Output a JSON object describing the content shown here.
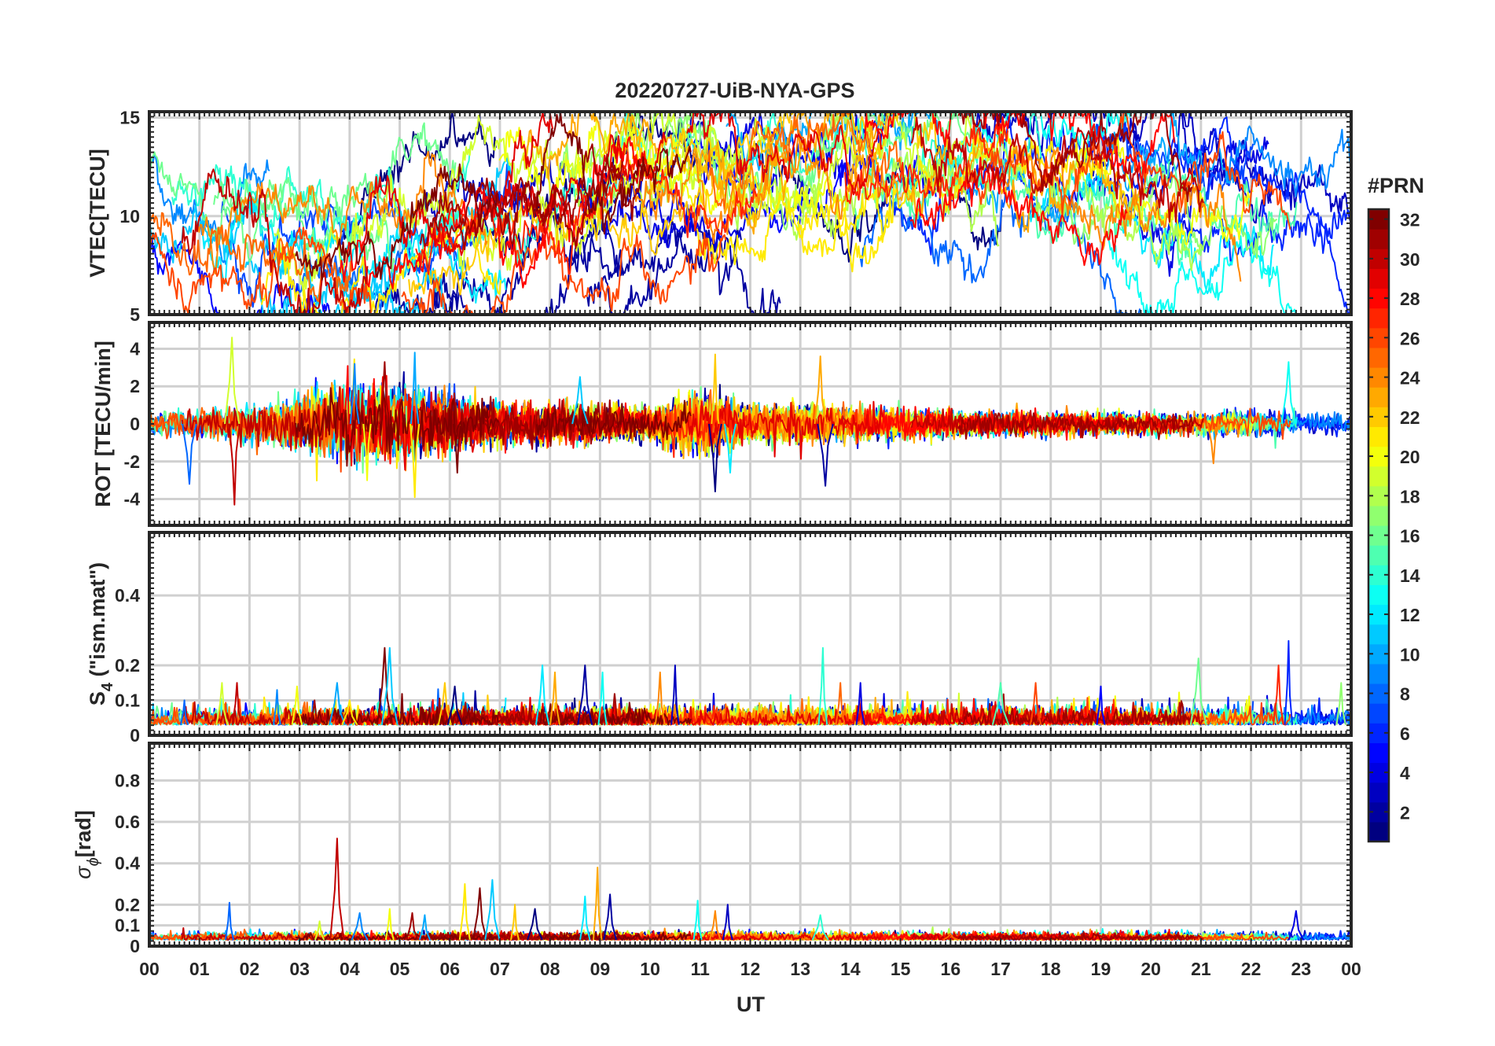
{
  "chart_data": {
    "type": "line",
    "title": "20220727-UiB-NYA-GPS",
    "xlabel": "UT",
    "x_tick_labels": [
      "00",
      "01",
      "02",
      "03",
      "04",
      "05",
      "06",
      "07",
      "08",
      "09",
      "10",
      "11",
      "12",
      "13",
      "14",
      "15",
      "16",
      "17",
      "18",
      "19",
      "20",
      "21",
      "22",
      "23",
      "00"
    ],
    "x_range_hours": [
      0,
      24
    ],
    "grid": true,
    "colorbar": {
      "label": "#PRN",
      "colormap": "jet",
      "range": [
        1,
        32
      ],
      "ticks": [
        2,
        4,
        6,
        8,
        10,
        12,
        14,
        16,
        18,
        20,
        22,
        24,
        26,
        28,
        30,
        32
      ],
      "placement": "right"
    },
    "panels": [
      {
        "id": "vtec",
        "ylabel": "VTEC[TECU]",
        "ylim": [
          5,
          15.3
        ],
        "yticks": [
          5,
          10,
          15
        ],
        "ytick_labels": [
          "5",
          "10",
          "15"
        ],
        "profile_hours": [
          0,
          1,
          2,
          3,
          4,
          5,
          6,
          7,
          8,
          9,
          10,
          11,
          12,
          13,
          14,
          15,
          16,
          17,
          18,
          19,
          20,
          21,
          22,
          23,
          24
        ],
        "profile_values": [
          10.5,
          9.5,
          8.8,
          8.0,
          7.8,
          8.5,
          9.5,
          10.0,
          10.5,
          11.0,
          11.5,
          12.0,
          11.5,
          11.5,
          12.0,
          12.5,
          12.5,
          12.5,
          12.0,
          11.5,
          11.0,
          10.5,
          10.5,
          10.5,
          10.0
        ],
        "spread": 1.6,
        "noise": 0.6
      },
      {
        "id": "rot",
        "ylabel": "ROT [TECU/min]",
        "ylim": [
          -5.4,
          5.4
        ],
        "yticks": [
          -4,
          -2,
          0,
          2,
          4
        ],
        "ytick_labels": [
          "-4",
          "-2",
          "0",
          "2",
          "4"
        ],
        "activity_hours": [
          0,
          1,
          2,
          3,
          4,
          5,
          6,
          7,
          8,
          9,
          10,
          11,
          12,
          13,
          14,
          15,
          16,
          17,
          18,
          19,
          20,
          21,
          22,
          23,
          24
        ],
        "activity_values": [
          0.35,
          0.4,
          0.5,
          0.8,
          1.1,
          1.1,
          0.8,
          0.6,
          0.6,
          0.55,
          0.45,
          0.9,
          0.5,
          0.6,
          0.5,
          0.45,
          0.4,
          0.35,
          0.35,
          0.3,
          0.3,
          0.3,
          0.35,
          0.3,
          0.3
        ],
        "peaks": [
          {
            "hour": 0.8,
            "value": -3.2
          },
          {
            "hour": 1.65,
            "value": 4.6
          },
          {
            "hour": 1.7,
            "value": -4.3
          },
          {
            "hour": 4.1,
            "value": 3.2
          },
          {
            "hour": 4.35,
            "value": -3.0
          },
          {
            "hour": 4.7,
            "value": 3.3
          },
          {
            "hour": 5.3,
            "value": 3.8
          },
          {
            "hour": 5.3,
            "value": -3.9
          },
          {
            "hour": 6.15,
            "value": -2.6
          },
          {
            "hour": 8.6,
            "value": 2.5
          },
          {
            "hour": 11.3,
            "value": 3.7
          },
          {
            "hour": 11.3,
            "value": -3.6
          },
          {
            "hour": 11.6,
            "value": -2.6
          },
          {
            "hour": 13.4,
            "value": 3.6
          },
          {
            "hour": 13.5,
            "value": -3.3
          },
          {
            "hour": 22.75,
            "value": 3.3
          },
          {
            "hour": 21.25,
            "value": -2.1
          }
        ]
      },
      {
        "id": "s4",
        "ylabel_main": "S",
        "ylabel_sub": "4",
        "ylabel_suffix": " (\"ism.mat\")",
        "ylim": [
          0,
          0.58
        ],
        "yticks": [
          0,
          0.1,
          0.2,
          0.4
        ],
        "ytick_labels": [
          "0",
          "0.1",
          "0.2",
          "0.4"
        ],
        "baseline": 0.03,
        "noise": 0.02,
        "peaks": [
          {
            "hour": 0.7,
            "value": 0.1
          },
          {
            "hour": 1.45,
            "value": 0.15
          },
          {
            "hour": 1.75,
            "value": 0.15
          },
          {
            "hour": 2.55,
            "value": 0.13
          },
          {
            "hour": 2.95,
            "value": 0.14
          },
          {
            "hour": 3.3,
            "value": 0.1
          },
          {
            "hour": 3.75,
            "value": 0.15
          },
          {
            "hour": 4.0,
            "value": 0.1
          },
          {
            "hour": 4.7,
            "value": 0.25
          },
          {
            "hour": 4.8,
            "value": 0.25
          },
          {
            "hour": 5.9,
            "value": 0.15
          },
          {
            "hour": 6.1,
            "value": 0.14
          },
          {
            "hour": 7.85,
            "value": 0.2
          },
          {
            "hour": 8.1,
            "value": 0.18
          },
          {
            "hour": 8.7,
            "value": 0.2
          },
          {
            "hour": 9.05,
            "value": 0.18
          },
          {
            "hour": 10.2,
            "value": 0.18
          },
          {
            "hour": 10.5,
            "value": 0.2
          },
          {
            "hour": 13.45,
            "value": 0.25
          },
          {
            "hour": 13.8,
            "value": 0.15
          },
          {
            "hour": 14.2,
            "value": 0.15
          },
          {
            "hour": 17.0,
            "value": 0.15
          },
          {
            "hour": 17.7,
            "value": 0.15
          },
          {
            "hour": 19.0,
            "value": 0.14
          },
          {
            "hour": 20.95,
            "value": 0.22
          },
          {
            "hour": 22.55,
            "value": 0.2
          },
          {
            "hour": 22.75,
            "value": 0.27
          },
          {
            "hour": 23.8,
            "value": 0.15
          }
        ]
      },
      {
        "id": "sigma",
        "ylabel_main": "σ",
        "ylabel_sub": "ϕ",
        "ylabel_suffix": "[rad]",
        "ylim": [
          0,
          0.98
        ],
        "yticks": [
          0,
          0.1,
          0.2,
          0.4,
          0.6,
          0.8
        ],
        "ytick_labels": [
          "0",
          "0.1",
          "0.2",
          "0.4",
          "0.6",
          "0.8"
        ],
        "baseline": 0.03,
        "noise": 0.015,
        "peaks": [
          {
            "hour": 1.6,
            "value": 0.21
          },
          {
            "hour": 3.4,
            "value": 0.12
          },
          {
            "hour": 3.75,
            "value": 0.52
          },
          {
            "hour": 4.2,
            "value": 0.16
          },
          {
            "hour": 4.8,
            "value": 0.18
          },
          {
            "hour": 5.25,
            "value": 0.16
          },
          {
            "hour": 5.5,
            "value": 0.15
          },
          {
            "hour": 6.3,
            "value": 0.3
          },
          {
            "hour": 6.6,
            "value": 0.28
          },
          {
            "hour": 6.85,
            "value": 0.32
          },
          {
            "hour": 7.3,
            "value": 0.2
          },
          {
            "hour": 7.7,
            "value": 0.18
          },
          {
            "hour": 8.7,
            "value": 0.24
          },
          {
            "hour": 8.95,
            "value": 0.38
          },
          {
            "hour": 9.2,
            "value": 0.25
          },
          {
            "hour": 10.95,
            "value": 0.22
          },
          {
            "hour": 11.3,
            "value": 0.17
          },
          {
            "hour": 11.55,
            "value": 0.2
          },
          {
            "hour": 13.4,
            "value": 0.15
          },
          {
            "hour": 16.0,
            "value": 0.06
          },
          {
            "hour": 22.9,
            "value": 0.17
          }
        ]
      }
    ]
  }
}
